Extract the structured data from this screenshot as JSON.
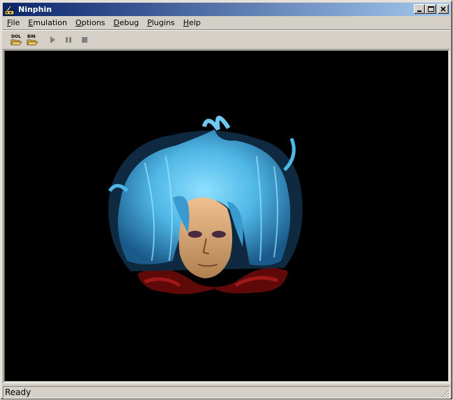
{
  "window": {
    "title": "Ninphin"
  },
  "menu": [
    {
      "label_u": "F",
      "label_rest": "ile"
    },
    {
      "label_u": "E",
      "label_rest": "mulation"
    },
    {
      "label_u": "O",
      "label_rest": "ptions"
    },
    {
      "label_u": "D",
      "label_rest": "ebug"
    },
    {
      "label_u": "P",
      "label_rest": "lugins"
    },
    {
      "label_u": "H",
      "label_rest": "elp"
    }
  ],
  "toolbar": {
    "open_dol_label": "DOL",
    "open_bin_label": "BIN",
    "icons": [
      "open-dol-icon",
      "open-bin-icon",
      "play-icon",
      "pause-icon",
      "stop-icon"
    ]
  },
  "colors": {
    "title_start": "#0a246a",
    "title_end": "#a6caf0",
    "display_bg": "#000000",
    "hair": "#4fb7e6",
    "face": "#d8a878"
  },
  "status": {
    "text": "Ready"
  }
}
